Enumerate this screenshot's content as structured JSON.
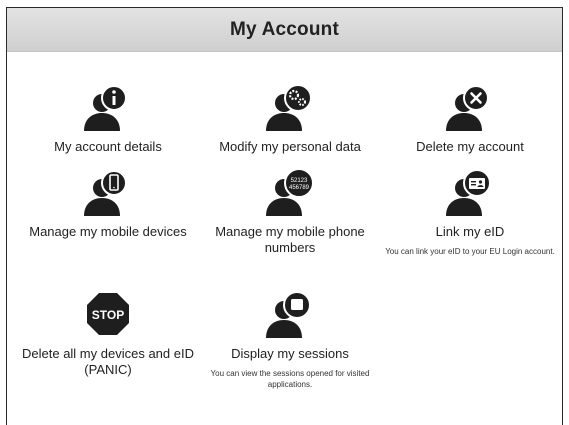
{
  "header": {
    "title": "My Account"
  },
  "tiles": [
    {
      "label": "My account details",
      "icon": "user-info-icon"
    },
    {
      "label": "Modify my personal data",
      "icon": "user-settings-icon"
    },
    {
      "label": "Delete my account",
      "icon": "user-delete-icon"
    },
    {
      "label": "Manage my mobile devices",
      "icon": "user-mobile-icon"
    },
    {
      "label": "Manage my mobile phone numbers",
      "icon": "user-phone-numbers-icon",
      "badge_text": [
        "52123",
        "456789"
      ]
    },
    {
      "label": "Link my eID",
      "icon": "user-id-card-icon",
      "description": "You can link your eID to your EU Login account."
    },
    {
      "label": "Delete all my devices and eID (PANIC)",
      "icon": "stop-sign-icon",
      "badge_text": "STOP"
    },
    {
      "label": "Display my sessions",
      "icon": "user-sessions-icon",
      "description": "You can view the sessions opened for visited applications."
    }
  ]
}
